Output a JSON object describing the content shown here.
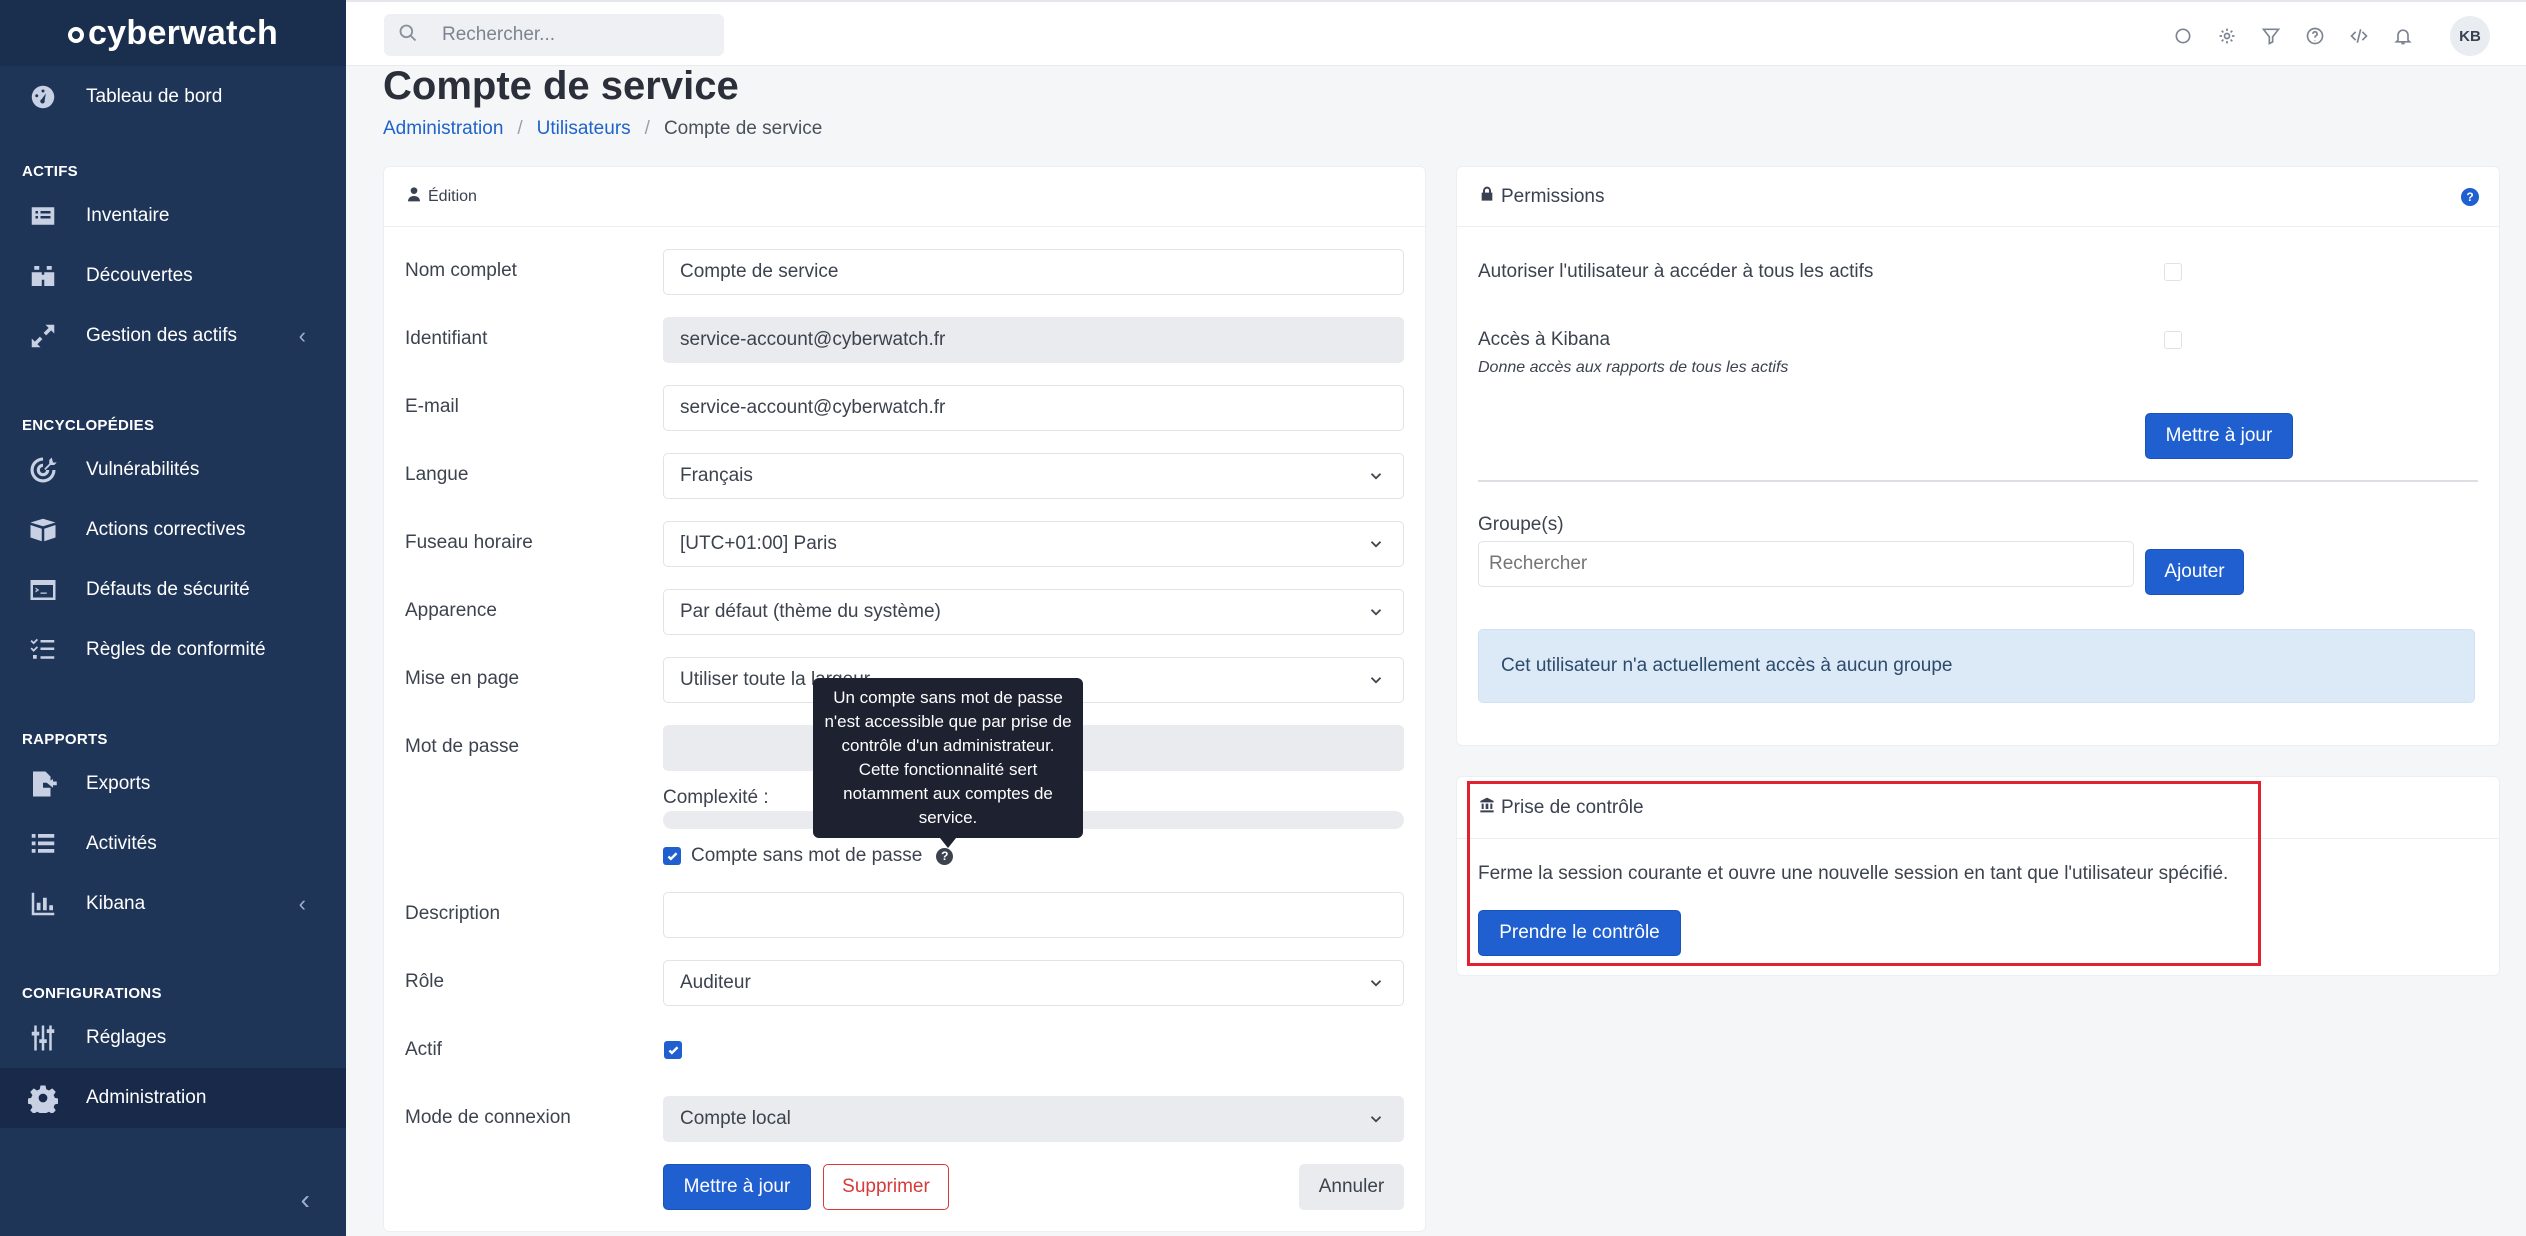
{
  "brand": {
    "name": "cyberwatch"
  },
  "sidebar": {
    "items": [
      {
        "label": "Tableau de bord",
        "icon": "dashboard-icon"
      },
      {
        "section": "ACTIFS"
      },
      {
        "label": "Inventaire",
        "icon": "list-icon"
      },
      {
        "label": "Découvertes",
        "icon": "binoculars-icon"
      },
      {
        "label": "Gestion des actifs",
        "icon": "expand-icon",
        "chevron": "‹"
      },
      {
        "section": "ENCYCLOPÉDIES"
      },
      {
        "label": "Vulnérabilités",
        "icon": "target-icon"
      },
      {
        "label": "Actions correctives",
        "icon": "box-icon"
      },
      {
        "label": "Défauts de sécurité",
        "icon": "terminal-icon"
      },
      {
        "label": "Règles de conformité",
        "icon": "checklist-icon"
      },
      {
        "section": "RAPPORTS"
      },
      {
        "label": "Exports",
        "icon": "file-export-icon"
      },
      {
        "label": "Activités",
        "icon": "activity-icon"
      },
      {
        "label": "Kibana",
        "icon": "chart-icon",
        "chevron": "‹"
      },
      {
        "section": "CONFIGURATIONS"
      },
      {
        "label": "Réglages",
        "icon": "sliders-icon"
      },
      {
        "label": "Administration",
        "icon": "gear-icon",
        "active": true
      }
    ],
    "collapse": "‹"
  },
  "topbar": {
    "search_placeholder": "Rechercher...",
    "avatar": "KB"
  },
  "page": {
    "title": "Compte de service",
    "breadcrumb": [
      "Administration",
      "Utilisateurs",
      "Compte de service"
    ]
  },
  "edition": {
    "header": "Édition",
    "fields": {
      "fullname": {
        "label": "Nom complet",
        "value": "Compte de service"
      },
      "login": {
        "label": "Identifiant",
        "value": "service-account@cyberwatch.fr"
      },
      "email": {
        "label": "E-mail",
        "value": "service-account@cyberwatch.fr"
      },
      "language": {
        "label": "Langue",
        "value": "Français"
      },
      "timezone": {
        "label": "Fuseau horaire",
        "value": "[UTC+01:00] Paris"
      },
      "appearance": {
        "label": "Apparence",
        "value": "Par défaut (thème du système)"
      },
      "layout": {
        "label": "Mise en page",
        "value": "Utiliser toute la largeur"
      },
      "password": {
        "label": "Mot de passe",
        "value": ""
      },
      "complexity": {
        "label": "Complexité :"
      },
      "passwordless": {
        "label": "Compte sans mot de passe",
        "checked": true
      },
      "description": {
        "label": "Description",
        "value": ""
      },
      "role": {
        "label": "Rôle",
        "value": "Auditeur"
      },
      "active": {
        "label": "Actif",
        "checked": true
      },
      "login_mode": {
        "label": "Mode de connexion",
        "value": "Compte local"
      }
    },
    "tooltip": "Un compte sans mot de passe n'est accessible que par prise de contrôle d'un administrateur. Cette fonctionnalité sert notamment aux comptes de service.",
    "buttons": {
      "update": "Mettre à jour",
      "delete": "Supprimer",
      "cancel": "Annuler"
    }
  },
  "permissions": {
    "header": "Permissions",
    "all_assets": {
      "label": "Autoriser l'utilisateur à accéder à tous les actifs",
      "checked": false
    },
    "kibana": {
      "label": "Accès à Kibana",
      "hint": "Donne accès aux rapports de tous les actifs",
      "checked": false
    },
    "update_button": "Mettre à jour",
    "groups": {
      "label": "Groupe(s)",
      "placeholder": "Rechercher",
      "add_button": "Ajouter"
    },
    "info": "Cet utilisateur n'a actuellement accès à aucun groupe"
  },
  "takeover": {
    "header": "Prise de contrôle",
    "description": "Ferme la session courante et ouvre une nouvelle session en tant que l'utilisateur spécifié.",
    "button": "Prendre le contrôle"
  },
  "colors": {
    "sidebar": "#1f3558",
    "primary": "#1f5fd0",
    "danger": "#d63a3a",
    "highlight": "#e0232e"
  }
}
